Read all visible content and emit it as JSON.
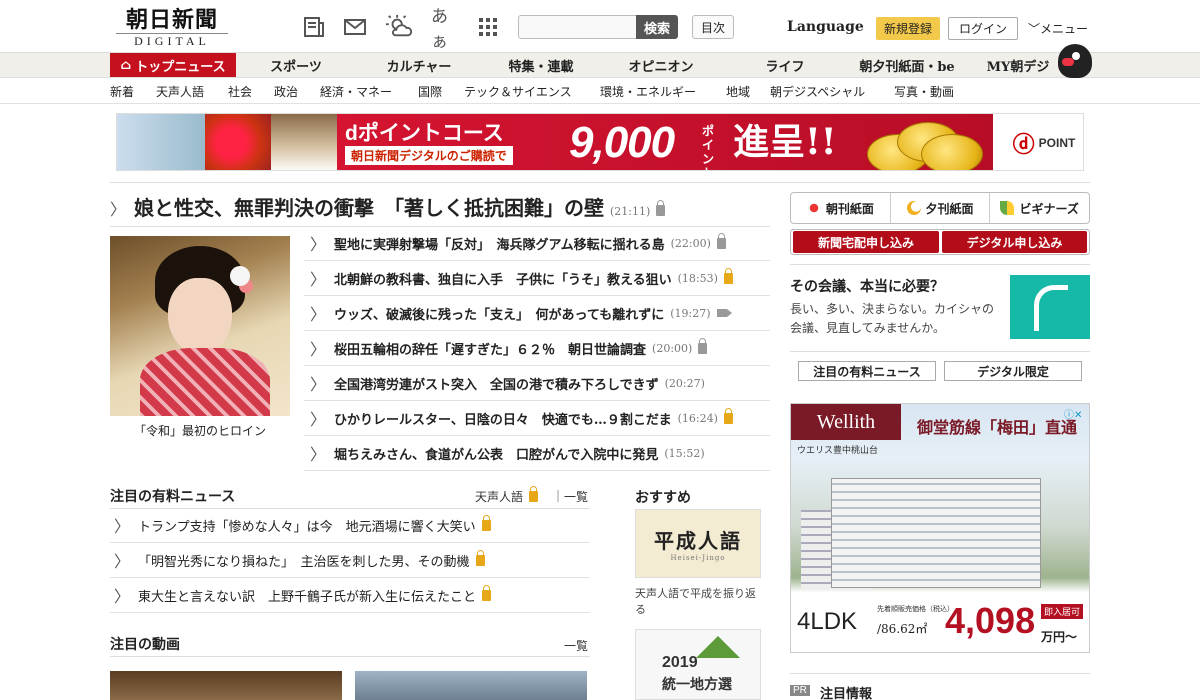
{
  "header": {
    "logo_ja": "朝日新聞",
    "logo_en": "DIGITAL",
    "icons": [
      "newspaper-icon",
      "mail-icon",
      "weather-icon",
      "font-size-icon",
      "grid-menu-icon"
    ],
    "font_size_glyph": "あぁ",
    "search_placeholder": "",
    "search_button": "検索",
    "contents_button": "目次",
    "language": "Language",
    "register": "新規登録",
    "login": "ログイン",
    "menu": "メニュー"
  },
  "nav_main": [
    {
      "label": "トップニュース",
      "active": true
    },
    {
      "label": "スポーツ"
    },
    {
      "label": "カルチャー"
    },
    {
      "label": "特集・連載"
    },
    {
      "label": "オピニオン"
    },
    {
      "label": "ライフ"
    },
    {
      "label": "朝夕刊紙面・be"
    },
    {
      "label": "MY朝デジ"
    }
  ],
  "nav_sub": [
    "新着",
    "天声人語",
    "社会",
    "政治",
    "経済・マネー",
    "国際",
    "テック＆サイエンス",
    "環境・エネルギー",
    "地域",
    "朝デジスペシャル",
    "写真・動画"
  ],
  "banner": {
    "title": "dポイントコース",
    "subtitle": "朝日新聞デジタルのご購読で",
    "amount": "9,000",
    "unit": "ポイント",
    "action": "進呈!!",
    "brand": "POINT"
  },
  "top_story": {
    "title": "娘と性交、無罪判決の衝撃　「著しく抵抗困難」の壁",
    "time": "(21:11)"
  },
  "photo_caption": "「令和」最初のヒロイン",
  "news": [
    {
      "title": "聖地に実弾射撃場「反対」　海兵隊グアム移転に揺れる島",
      "time": "(22:00)",
      "mark": "lock"
    },
    {
      "title": "北朝鮮の教科書、独自に入手　子供に「うそ」教える狙い",
      "time": "(18:53)",
      "mark": "lock-gold"
    },
    {
      "title": "ウッズ、破滅後に残った「支え」　何があっても離れずに",
      "time": "(19:27)",
      "mark": "video"
    },
    {
      "title": "桜田五輪相の辞任「遅すぎた」６２％　朝日世論調査",
      "time": "(20:00)",
      "mark": "lock"
    },
    {
      "title": "全国港湾労連がスト突入　全国の港で積み下ろしできず",
      "time": "(20:27)",
      "mark": ""
    },
    {
      "title": "ひかりレールスター、日陰の日々　快適でも…９割こだま",
      "time": "(16:24)",
      "mark": "lock-gold"
    },
    {
      "title": "堀ちえみさん、食道がん公表　口腔がんで入院中に発見",
      "time": "(15:52)",
      "mark": ""
    }
  ],
  "paid_section": {
    "title": "注目の有料ニュース",
    "link1": "天声人語",
    "link2": "一覧",
    "items": [
      "トランプ支持「惨めな人々」は今　地元酒場に響く大笑い",
      "「明智光秀になり損ねた」　主治医を刺した男、その動機",
      "東大生と言えない訳　上野千鶴子氏が新入生に伝えたこと"
    ]
  },
  "video_section": {
    "title": "注目の動画",
    "link": "一覧"
  },
  "recommend": {
    "title": "おすすめ",
    "item1_image_text": "平成人語",
    "item1_image_sub": "Heisei-Jingo",
    "item1_caption": "天声人語で平成を振り返る",
    "item2_year": "2019",
    "item2_title": "統一地方選"
  },
  "edition": [
    "朝刊紙面",
    "夕刊紙面",
    "ビギナーズ"
  ],
  "apply": [
    "新聞宅配申し込み",
    "デジタル申し込み"
  ],
  "promo": {
    "title": "その会議、本当に必要？",
    "text": "長い、多い、決まらない。カイシャの会議、見直してみませんか。"
  },
  "tabs": [
    "注目の有料ニュース",
    "デジタル限定"
  ],
  "ad": {
    "brand": "Wellith",
    "sub": "ウエリス豊中桃山台",
    "headline": "御堂筋線「梅田」直通",
    "layout": "4LDK",
    "area": "/86.62㎡",
    "note": "先着順販売価格（税込）",
    "price": "4,098",
    "yen": "万円～",
    "tag": "即入居可"
  },
  "pr": {
    "badge": "PR",
    "title": "注目情報"
  },
  "colors": {
    "brand_red": "#c5101e",
    "nav_bg": "#f0efe9",
    "accent_gold": "#e6a817",
    "register_yellow": "#f3c94b"
  }
}
